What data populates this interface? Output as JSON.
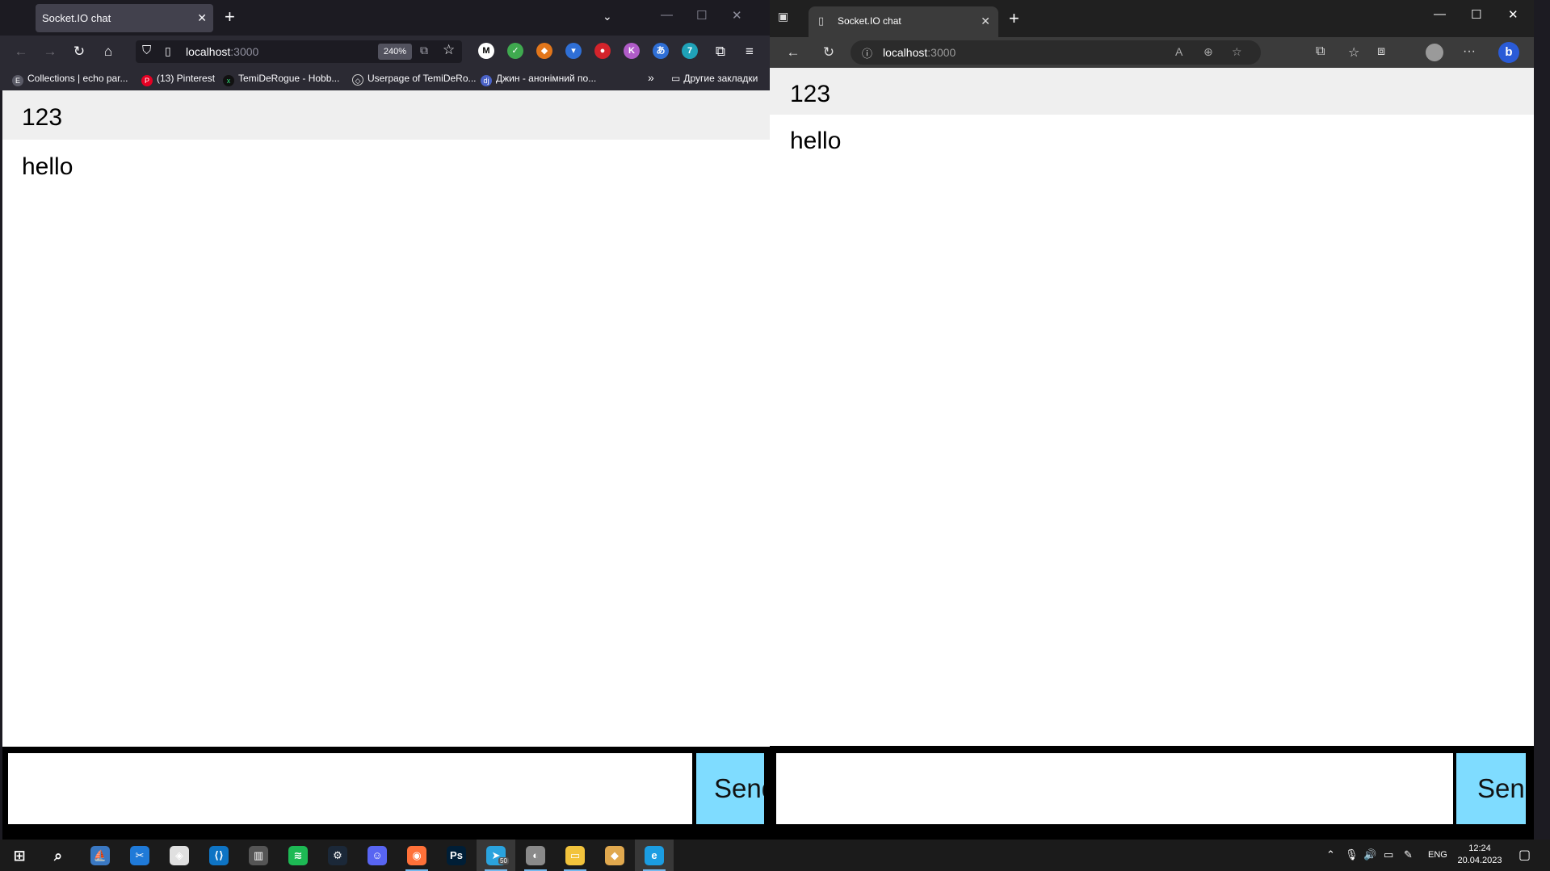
{
  "firefox": {
    "tab_title": "Socket.IO chat",
    "url_host": "localhost",
    "url_port": ":3000",
    "zoom": "240%",
    "bookmarks": [
      {
        "label": "Collections | echo par...",
        "icon": "collections-icon",
        "color": "#5a5a66"
      },
      {
        "label": "(13) Pinterest",
        "icon": "pinterest-icon",
        "color": "#e60023"
      },
      {
        "label": "TemiDeRogue - Hobb...",
        "icon": "hobbyx-icon",
        "color": "#111111"
      },
      {
        "label": "Userpage of TemiDeRo...",
        "icon": "userpage-icon",
        "color": "#2b2a33"
      },
      {
        "label": "Джин - анонімний по...",
        "icon": "djinni-icon",
        "color": "#4a62c7"
      }
    ],
    "other_bookmarks": "Другие закладки"
  },
  "edge": {
    "tab_title": "Socket.IO chat",
    "url_host": "localhost",
    "url_port": ":3000"
  },
  "chat": {
    "messages": [
      "123",
      "hello"
    ],
    "send_label": "Send"
  },
  "taskbar": {
    "apps": [
      {
        "name": "explorer-app-icon",
        "color": "#3a78c2",
        "glyph": "⛵"
      },
      {
        "name": "snip-app-icon",
        "color": "#1f7ad8",
        "glyph": "✂"
      },
      {
        "name": "unity-app-icon",
        "color": "#e0e0e0",
        "glyph": "◈"
      },
      {
        "name": "vscode-app-icon",
        "color": "#0e74c4",
        "glyph": "⟨⟩"
      },
      {
        "name": "app-icon",
        "color": "#555555",
        "glyph": "▥"
      },
      {
        "name": "spotify-app-icon",
        "color": "#1db954",
        "glyph": "≋"
      },
      {
        "name": "steam-app-icon",
        "color": "#1b2838",
        "glyph": "⚙"
      },
      {
        "name": "discord-app-icon",
        "color": "#5865f2",
        "glyph": "☺"
      },
      {
        "name": "firefox-app-icon",
        "color": "#ff7139",
        "glyph": "◉"
      },
      {
        "name": "photoshop-app-icon",
        "color": "#001e36",
        "glyph": "Ps"
      },
      {
        "name": "telegram-app-icon",
        "color": "#2aa3de",
        "glyph": "➤"
      },
      {
        "name": "shield-app-icon",
        "color": "#8a8a8a",
        "glyph": "◐"
      },
      {
        "name": "files-app-icon",
        "color": "#f2c33c",
        "glyph": "▭"
      },
      {
        "name": "git-app-icon",
        "color": "#e0a84e",
        "glyph": "◆"
      },
      {
        "name": "edge-app-icon",
        "color": "#1b9de2",
        "glyph": "e"
      }
    ],
    "telegram_badge": "50",
    "language": "ENG",
    "time": "12:24",
    "date": "20.04.2023"
  },
  "colors": {
    "send_button_bg": "#7fdcff",
    "odd_message_bg": "#efefef"
  }
}
